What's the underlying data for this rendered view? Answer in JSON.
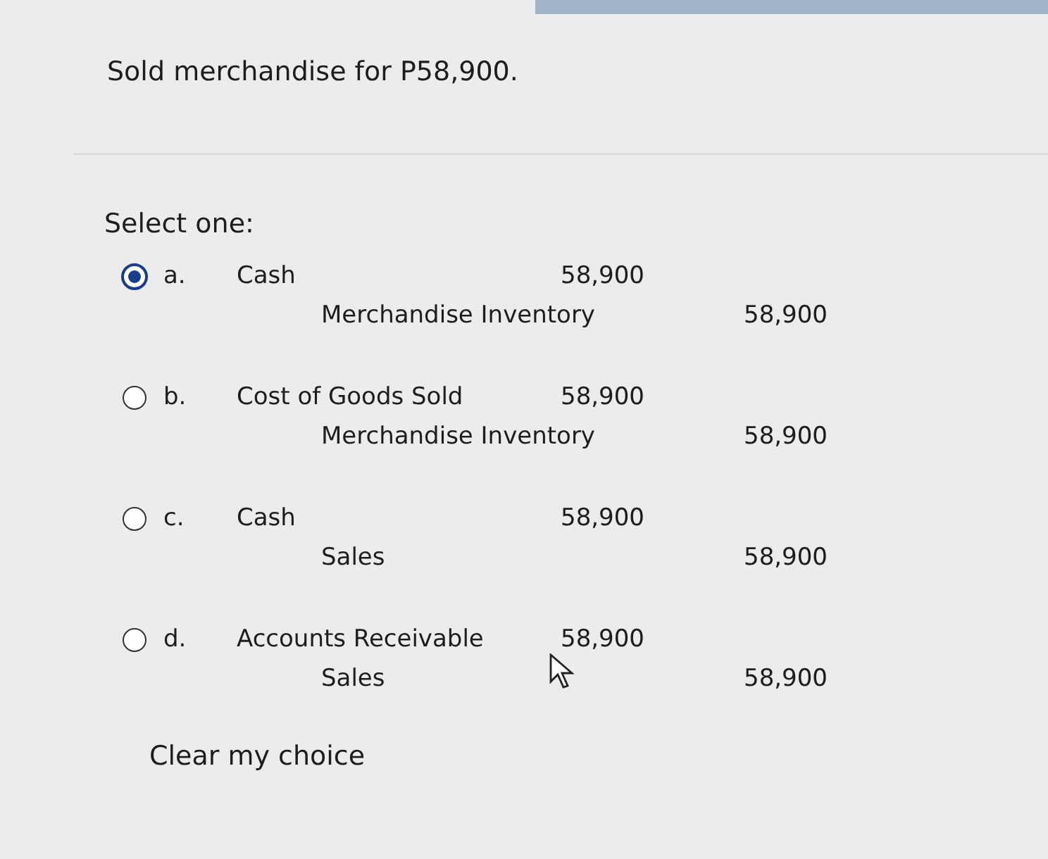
{
  "question": "Sold merchandise for P58,900.",
  "prompt": "Select one:",
  "options": [
    {
      "letter": "a.",
      "selected": true,
      "debit_account": "Cash",
      "debit_amount": "58,900",
      "credit_account": "Merchandise Inventory",
      "credit_amount": "58,900"
    },
    {
      "letter": "b.",
      "selected": false,
      "debit_account": "Cost of Goods Sold",
      "debit_amount": "58,900",
      "credit_account": "Merchandise Inventory",
      "credit_amount": "58,900"
    },
    {
      "letter": "c.",
      "selected": false,
      "debit_account": "Cash",
      "debit_amount": "58,900",
      "credit_account": "Sales",
      "credit_amount": "58,900"
    },
    {
      "letter": "d.",
      "selected": false,
      "debit_account": "Accounts Receivable",
      "debit_amount": "58,900",
      "credit_account": "Sales",
      "credit_amount": "58,900"
    }
  ],
  "clear_link": "Clear my choice"
}
